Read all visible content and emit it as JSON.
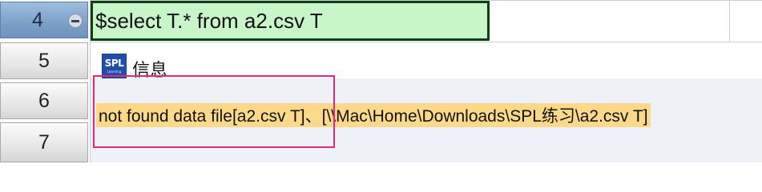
{
  "rows": [
    {
      "number": "4",
      "active": true
    },
    {
      "number": "5",
      "active": false
    },
    {
      "number": "6",
      "active": false
    },
    {
      "number": "7",
      "active": false
    }
  ],
  "formula_cell": {
    "text": "$select T.* from a2.csv T"
  },
  "result": {
    "logo_text": "SPL",
    "logo_subtext": "Learning",
    "info_label": "信息",
    "error_message": "not found data file[a2.csv T]、[\\\\Mac\\Home\\Downloads\\SPL练习\\a2.csv T]"
  },
  "colors": {
    "formula_cell_bg": "#c8f6c8",
    "formula_cell_border": "#123f12",
    "active_row_header": "#7c9fc8",
    "error_highlight": "#ffd98a",
    "annotation_border": "#e0297a",
    "message_area_bg": "#eef1f7"
  },
  "icons": {
    "collapse": "minus-circle-icon",
    "logo": "spl-logo-icon"
  }
}
